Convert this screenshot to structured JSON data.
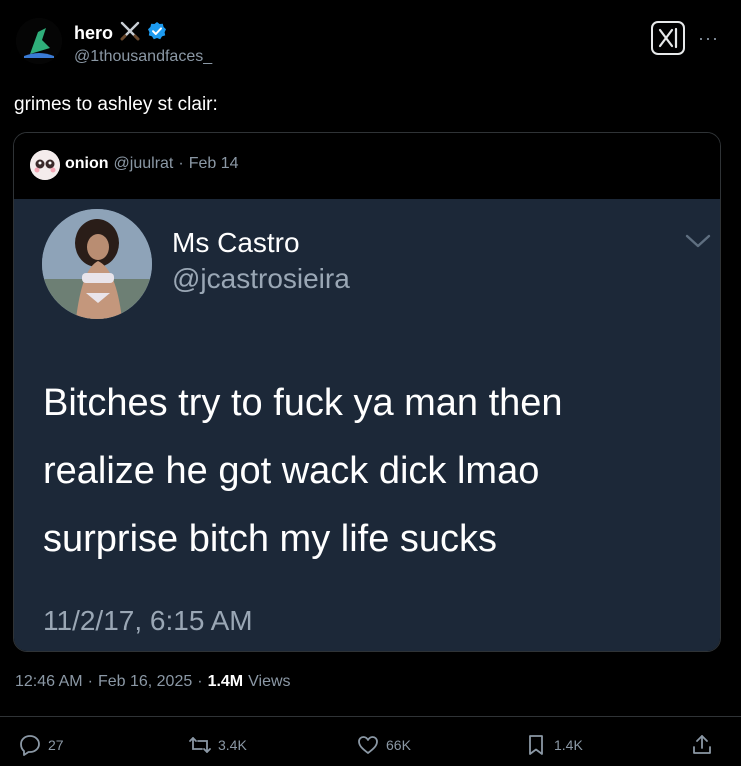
{
  "header": {
    "display_name": "hero",
    "name_badges": [
      "crossed-swords-icon",
      "verified-badge-icon"
    ],
    "handle": "@1thousandfaces_"
  },
  "tweet": {
    "text": "grimes to ashley st clair:"
  },
  "quote": {
    "author_name": "onion",
    "author_handle": "@juulrat",
    "separator": "·",
    "date": "Feb 14",
    "embedded_tweet": {
      "name": "Ms Castro",
      "handle": "@jcastrosieira",
      "lines": [
        "Bitches try to fuck ya man then",
        "realize he got wack dick lmao",
        "surprise bitch my life sucks"
      ],
      "timestamp": "11/2/17, 6:15 AM"
    }
  },
  "meta": {
    "time": "12:46 AM",
    "sep1": "·",
    "date": "Feb 16, 2025",
    "sep2": "·",
    "views_count": "1.4M",
    "views_label": "Views"
  },
  "actions": {
    "replies": "27",
    "reposts": "3.4K",
    "likes": "66K",
    "bookmarks": "1.4K"
  },
  "colors": {
    "background": "#000000",
    "text_primary": "#e7e9ea",
    "text_secondary": "#8b98a5",
    "verified": "#1d9bf0",
    "screenshot_bg": "#1c2838"
  }
}
